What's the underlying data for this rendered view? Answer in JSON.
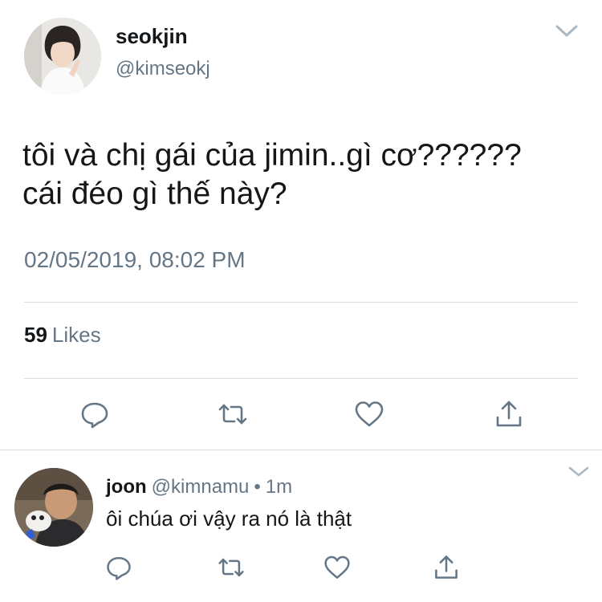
{
  "tweet": {
    "display_name": "seokjin",
    "handle": "@kimseokj",
    "text_line1": "tôi và chị gái của jimin..gì cơ??????",
    "text_line2": "cái đéo gì thế này?",
    "timestamp": "02/05/2019, 08:02 PM",
    "likes_count": "59",
    "likes_label": "Likes",
    "actions": [
      "reply-icon",
      "retweet-icon",
      "like-icon",
      "share-icon"
    ]
  },
  "reply": {
    "display_name": "joon",
    "handle": "@kimnamu",
    "separator": "•",
    "time": "1m",
    "text": "ôi chúa ơi vậy ra nó là thật",
    "actions": [
      "reply-icon",
      "retweet-icon",
      "like-icon",
      "share-icon"
    ]
  },
  "colors": {
    "text_primary": "#14171a",
    "text_secondary": "#657786",
    "divider": "#d8dde2",
    "icon": "#657786"
  }
}
